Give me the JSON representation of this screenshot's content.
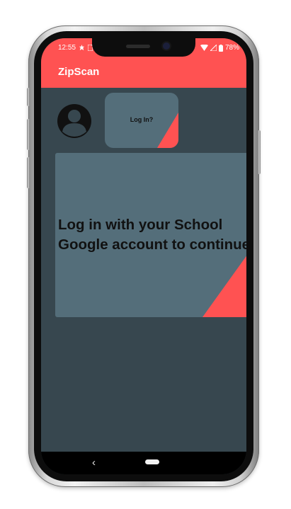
{
  "status_bar": {
    "time": "12:55",
    "battery": "78%",
    "notification_icons": [
      "notification-icon",
      "sim-icon"
    ],
    "right_icons": [
      "wifi-icon",
      "signal-icon",
      "battery-icon"
    ]
  },
  "app_bar": {
    "title": "ZipScan"
  },
  "login_button": {
    "label": "Log In?"
  },
  "message_card": {
    "line1": "Log in with your School",
    "line2": "Google account to continue."
  },
  "nav_bar": {
    "back_glyph": "‹"
  },
  "colors": {
    "accent": "#ff5252",
    "background": "#37474f",
    "card": "#546e7a"
  }
}
